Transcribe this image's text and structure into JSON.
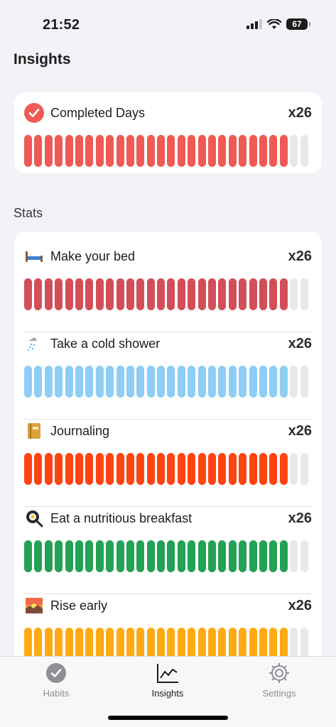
{
  "status_bar": {
    "time": "21:52",
    "battery": "67"
  },
  "page": {
    "title": "Insights"
  },
  "summary": {
    "icon": "checkmark-circle-icon",
    "label": "Completed Days",
    "count": "x26",
    "color": "#ef5a55",
    "completed": 26,
    "total": 28
  },
  "stats": {
    "title": "Stats",
    "habits": [
      {
        "icon": "bed-icon",
        "name": "Make your bed",
        "count": "x26",
        "color": "#d24f5a",
        "completed": 26,
        "total": 28
      },
      {
        "icon": "shower-icon",
        "name": "Take a cold shower",
        "count": "x26",
        "color": "#8ecdf5",
        "completed": 26,
        "total": 28
      },
      {
        "icon": "notebook-icon",
        "name": "Journaling",
        "count": "x26",
        "color": "#ff4411",
        "completed": 26,
        "total": 28
      },
      {
        "icon": "frying-pan-icon",
        "name": "Eat a nutritious breakfast",
        "count": "x26",
        "color": "#23a154",
        "completed": 26,
        "total": 28
      },
      {
        "icon": "sunrise-icon",
        "name": "Rise early",
        "count": "x26",
        "color": "#ffaa12",
        "completed": 26,
        "total": 28
      }
    ]
  },
  "tab_bar": {
    "tabs": [
      {
        "icon": "checkmark-circle-icon",
        "label": "Habits",
        "active": false
      },
      {
        "icon": "chart-line-icon",
        "label": "Insights",
        "active": true
      },
      {
        "icon": "gear-icon",
        "label": "Settings",
        "active": false
      }
    ]
  },
  "colors": {
    "empty_bar": "#e8e8ea"
  }
}
